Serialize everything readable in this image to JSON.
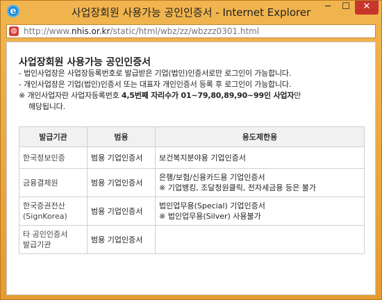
{
  "window": {
    "title": "사업장회원 사용가능 공인인증서 - Internet Explorer",
    "controls": {
      "minimize": "─",
      "maximize": "☐",
      "close": "✕"
    }
  },
  "address": {
    "prefix": "http://www.",
    "domain": "nhis.or.kr",
    "path": "/static/html/wbz/zz/wbzzz0301.html"
  },
  "page": {
    "heading": "사업장회원 사용가능 공인인증서",
    "notes": [
      "- 법인사업장은 사업장등록번호로 발급받은 기업(법인)인증서로만 로그인이 가능합니다.",
      "- 개인사업장은 기업(법인)인증서 또는 대표자 개인인증서 등록 후 로그인이 가능합니다."
    ],
    "note3_before": "※ 개인사업자란 사업자등록번호 ",
    "note3_emph": "4,5번째 자리수가 01~79,80,89,90~99인 사업자",
    "note3_after": "만",
    "note3_line2": "해당됩니다."
  },
  "table": {
    "headers": [
      "발급기관",
      "범용",
      "용도제한용"
    ],
    "rows": [
      {
        "org": [
          "한국정보인증"
        ],
        "type": "범용 기업인증서",
        "limit": [
          "보건복지분야용 기업인증서"
        ]
      },
      {
        "org": [
          "금융결제원"
        ],
        "type": "범용 기업인증서",
        "limit": [
          "은행/보험/신용카드용 기업인증서",
          "※ 기업뱅킹, 조달청원클릭, 전자세금용 등은 불가"
        ]
      },
      {
        "org": [
          "한국증권전산",
          "(SignKorea)"
        ],
        "type": "범용 기업인증서",
        "limit": [
          "법인업무용(Special) 기업인증서",
          "※ 법인업무용(Silver) 사용불가"
        ]
      },
      {
        "org": [
          "타 공인인증서",
          "발급기관"
        ],
        "type": "범용 기업인증서",
        "limit": []
      }
    ]
  }
}
